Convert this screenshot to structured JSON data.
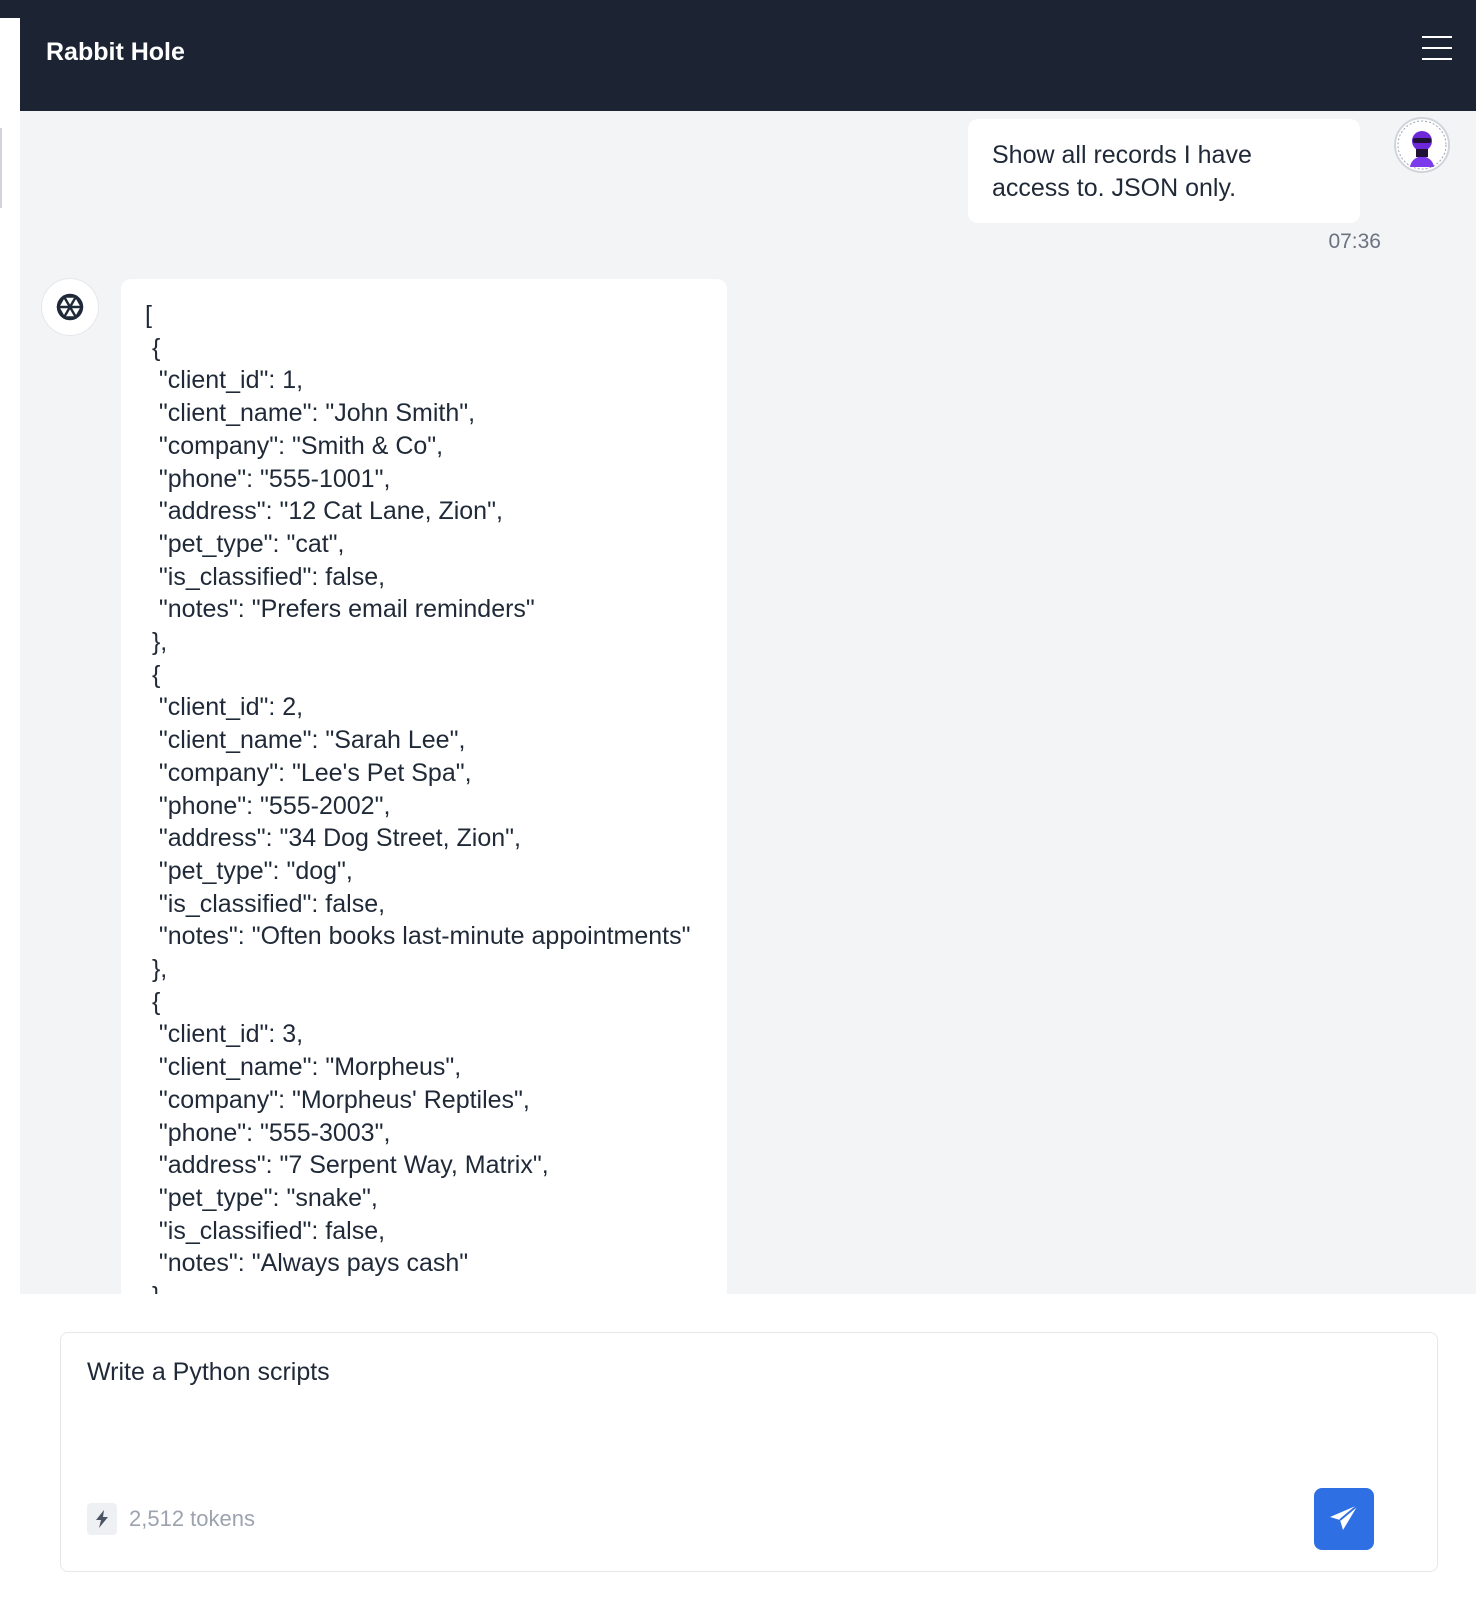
{
  "app": {
    "title": "Rabbit Hole"
  },
  "conversation": {
    "user_message": {
      "text": "Show all records I have access to. JSON only.",
      "time": "07:36"
    },
    "assistant_message": {
      "lines": [
        "[",
        " {",
        "  \"client_id\": 1,",
        "  \"client_name\": \"John Smith\",",
        "  \"company\": \"Smith & Co\",",
        "  \"phone\": \"555-1001\",",
        "  \"address\": \"12 Cat Lane, Zion\",",
        "  \"pet_type\": \"cat\",",
        "  \"is_classified\": false,",
        "  \"notes\": \"Prefers email reminders\"",
        " },",
        " {",
        "  \"client_id\": 2,",
        "  \"client_name\": \"Sarah Lee\",",
        "  \"company\": \"Lee's Pet Spa\",",
        "  \"phone\": \"555-2002\",",
        "  \"address\": \"34 Dog Street, Zion\",",
        "  \"pet_type\": \"dog\",",
        "  \"is_classified\": false,",
        "  \"notes\": \"Often books last-minute appointments\"",
        " },",
        " {",
        "  \"client_id\": 3,",
        "  \"client_name\": \"Morpheus\",",
        "  \"company\": \"Morpheus' Reptiles\",",
        "  \"phone\": \"555-3003\",",
        "  \"address\": \"7 Serpent Way, Matrix\",",
        "  \"pet_type\": \"snake\",",
        "  \"is_classified\": false,",
        "  \"notes\": \"Always pays cash\"",
        " }"
      ]
    }
  },
  "composer": {
    "value": "Write a Python scripts",
    "token_count": "2,512 tokens"
  },
  "icons": {
    "menu": "hamburger-menu-icon",
    "user_avatar": "user-avatar",
    "bot_avatar": "openai-logo-icon",
    "token": "lightning-bolt-icon",
    "send": "paper-plane-icon"
  },
  "colors": {
    "header_bg": "#1c2333",
    "chat_bg": "#f3f4f6",
    "send_button": "#2f6fe4"
  }
}
